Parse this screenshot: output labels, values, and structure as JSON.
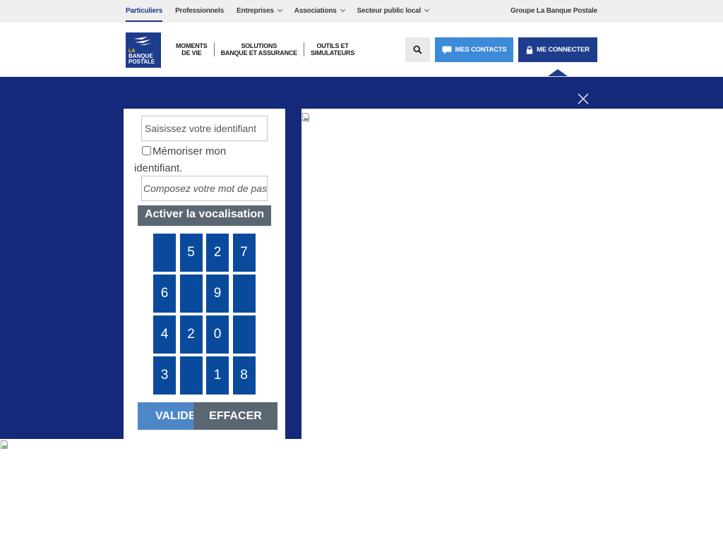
{
  "topbar": {
    "items": [
      {
        "label": "Particuliers",
        "active": true,
        "dropdown": false
      },
      {
        "label": "Professionnels",
        "active": false,
        "dropdown": false
      },
      {
        "label": "Entreprises",
        "active": false,
        "dropdown": true
      },
      {
        "label": "Associations",
        "active": false,
        "dropdown": true
      },
      {
        "label": "Secteur public local",
        "active": false,
        "dropdown": true
      }
    ],
    "group_link": "Groupe La Banque Postale"
  },
  "header": {
    "logo": {
      "line1": "LA",
      "line2": "BANQUE",
      "line3": "POSTALE"
    },
    "nav": [
      {
        "line1": "MOMENTS",
        "line2": "DE VIE"
      },
      {
        "line1": "SOLUTIONS",
        "line2": "BANQUE ET ASSURANCE"
      },
      {
        "line1": "OUTILS ET",
        "line2": "SIMULATEURS"
      }
    ],
    "search_icon": "search-icon",
    "contacts_label": "MES CONTACTS",
    "connect_label": "ME CONNECTER"
  },
  "colors": {
    "brand_blue": "#1e3c8c",
    "overlay_blue": "#14297a",
    "key_blue": "#0a4a9d",
    "contacts_blue": "#3d8ad8",
    "button_grey": "#5a6671"
  },
  "login": {
    "id_placeholder": "Saisissez votre identifiant",
    "remember_label": "Mémoriser mon identifiant.",
    "password_placeholder": "Composez votre mot de passe",
    "vocalisation_label": "Activer la vocalisation",
    "keypad": [
      "",
      "5",
      "2",
      "7",
      "6",
      "",
      "9",
      "",
      "4",
      "2",
      "0",
      "",
      "3",
      "",
      "1",
      "8"
    ],
    "validate_label": "VALIDER",
    "clear_label": "EFFACER"
  }
}
